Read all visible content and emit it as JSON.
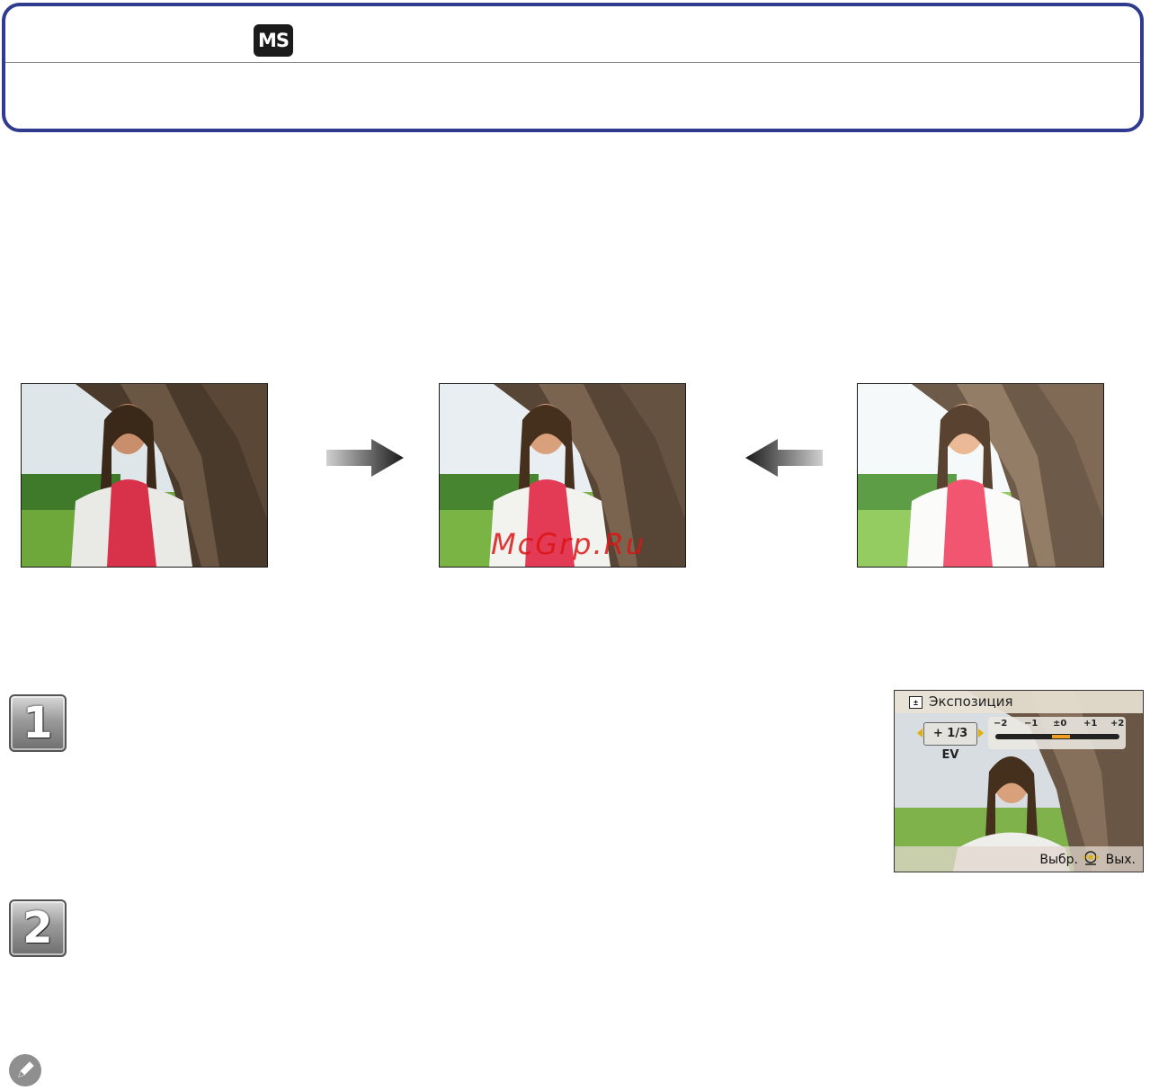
{
  "header": {
    "mode_badge": "MS"
  },
  "photos": [
    {
      "label": "underexposed-photo",
      "brightness": 0.82
    },
    {
      "label": "correct-exposure-photo",
      "brightness": 1.0
    },
    {
      "label": "overexposed-photo",
      "brightness": 1.22
    }
  ],
  "watermark": "McGrp.Ru",
  "steps": [
    {
      "number": "1"
    },
    {
      "number": "2"
    }
  ],
  "camera_screen": {
    "title": "Экспозиция",
    "ev_value": "+ 1/3 EV",
    "scale_labels": [
      "−2",
      "−1",
      "±0",
      "+1",
      "+2"
    ],
    "footer_select": "Выбр.",
    "footer_exit": "Вых."
  },
  "colors": {
    "header_border": "#2e3b8f",
    "scale_marker": "#f0a020",
    "watermark": "#dc1414"
  }
}
